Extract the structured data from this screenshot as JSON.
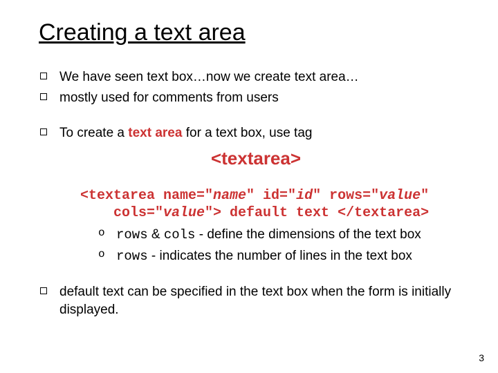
{
  "title": "Creating a text area",
  "bullets": {
    "b1": "We have seen text box…now we create text area…",
    "b2": "mostly used for comments from users",
    "b3_pre": "To create a ",
    "b3_em": "text area",
    "b3_post": " for a text box, use tag",
    "b4": "default text can be specified in the text box when the form is initially displayed."
  },
  "tag": "<textarea>",
  "code": {
    "l1a": "<textarea name=\"",
    "l1b": "name",
    "l1c": "\" id=\"",
    "l1d": "id",
    "l1e": "\" rows=\"",
    "l1f": "value",
    "l1g": "\"",
    "l2a": "cols=\"",
    "l2b": "value",
    "l2c": "\"> default text </textarea>"
  },
  "sub": {
    "s1a": "rows",
    "s1b": " & ",
    "s1c": "cols",
    "s1d": "  - define the dimensions of the text box",
    "s2a": "rows",
    "s2b": "  - indicates the number of lines in the text box"
  },
  "page": "3"
}
